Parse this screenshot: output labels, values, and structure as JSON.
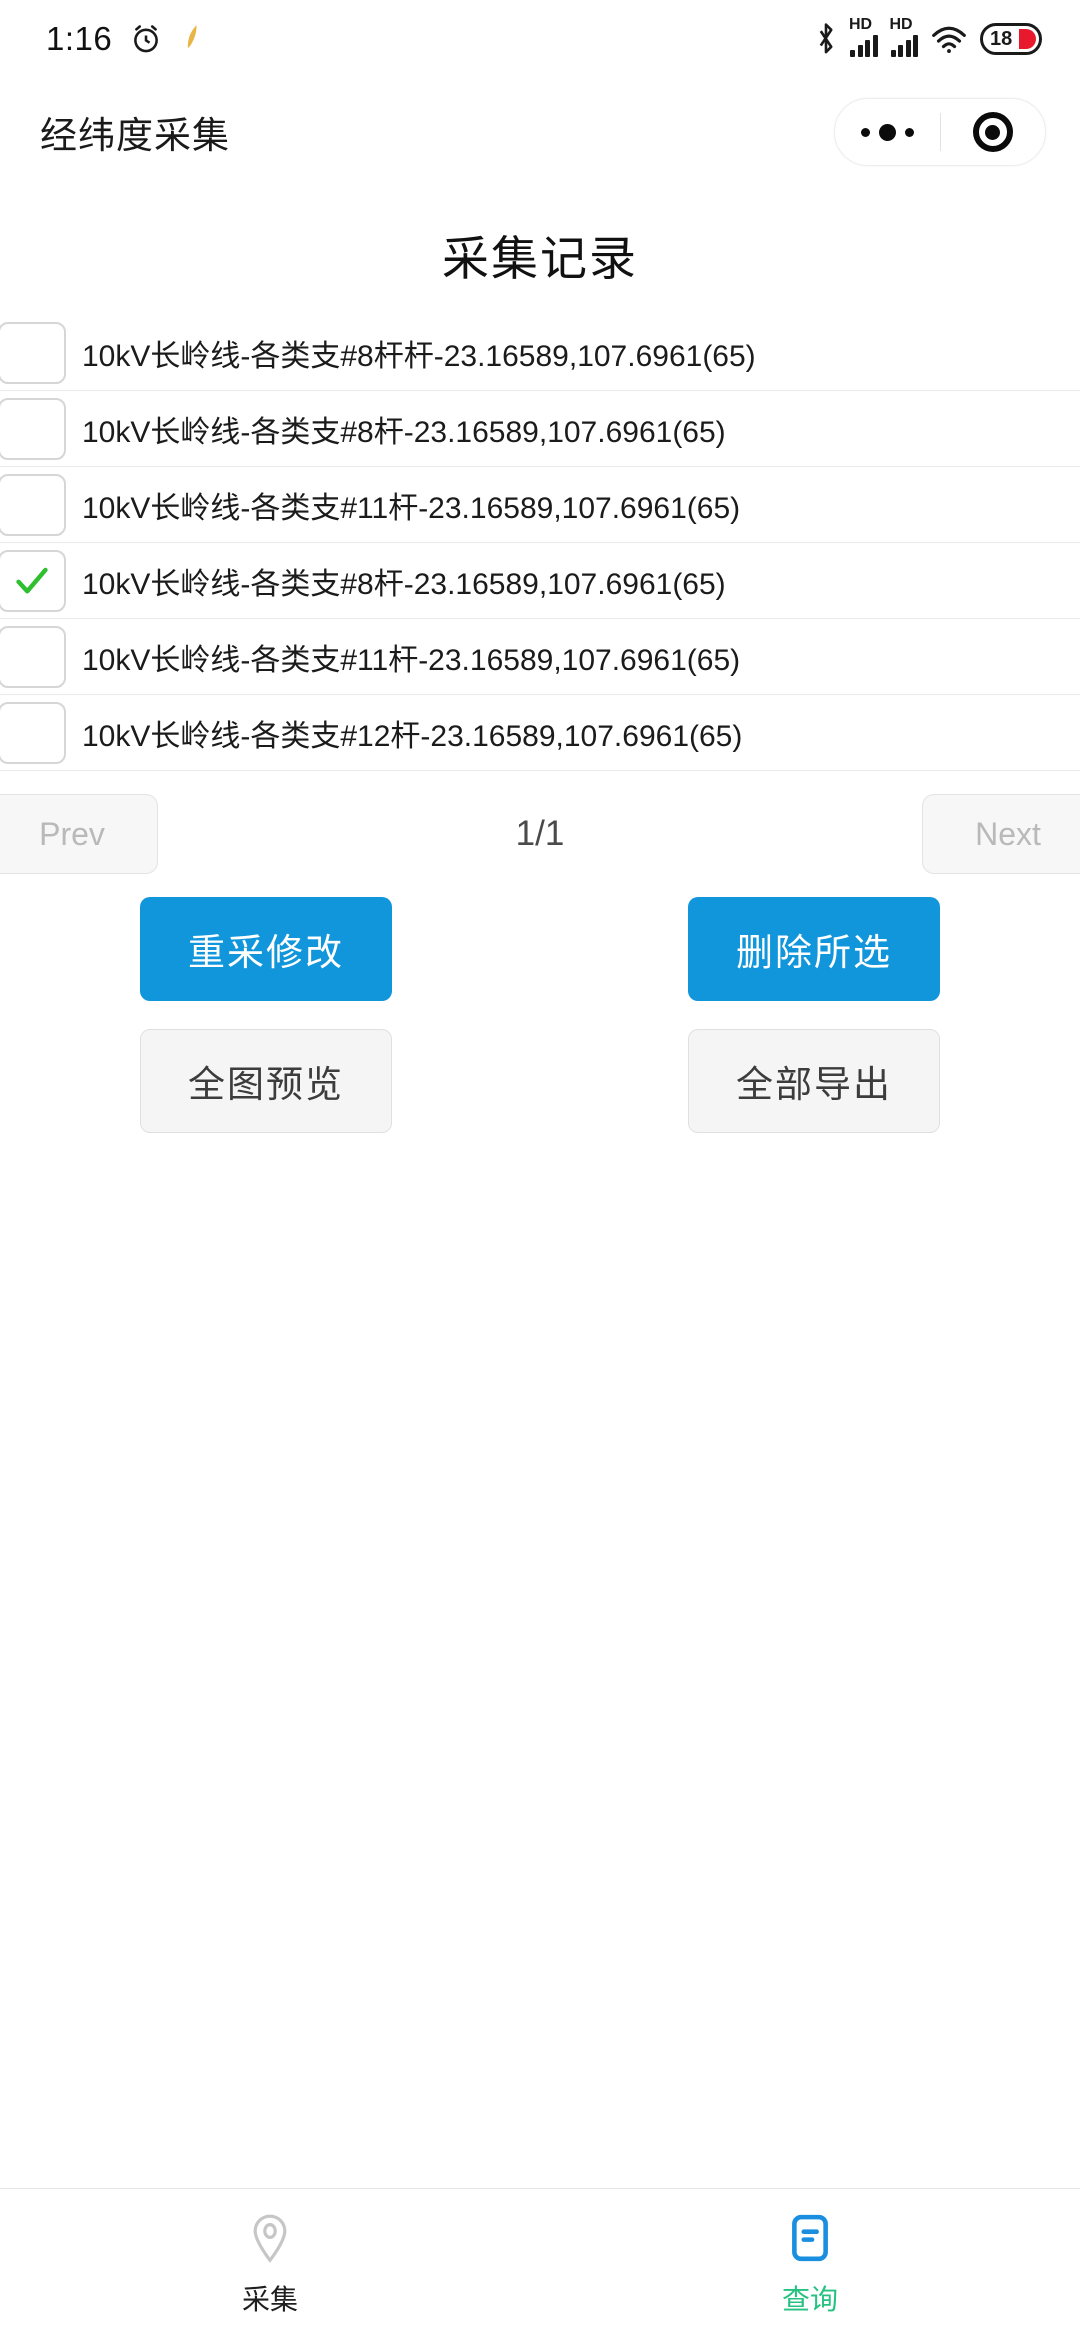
{
  "status_bar": {
    "time": "1:16",
    "alarm_icon": "alarm-clock-icon",
    "feather_icon": "feather-icon",
    "bluetooth_icon": "bluetooth-icon",
    "signal1_label": "HD",
    "signal2_label": "HD",
    "wifi_icon": "wifi-icon",
    "battery_level": "18"
  },
  "header": {
    "app_title": "经纬度采集",
    "more_icon": "more-dots-icon",
    "target_icon": "target-circle-icon"
  },
  "page": {
    "title": "采集记录"
  },
  "records": [
    {
      "label": "10kV长岭线-各类支#8杆杆-23.16589,107.6961(65)",
      "checked": false
    },
    {
      "label": "10kV长岭线-各类支#8杆-23.16589,107.6961(65)",
      "checked": false
    },
    {
      "label": "10kV长岭线-各类支#11杆-23.16589,107.6961(65)",
      "checked": false
    },
    {
      "label": "10kV长岭线-各类支#8杆-23.16589,107.6961(65)",
      "checked": true
    },
    {
      "label": "10kV长岭线-各类支#11杆-23.16589,107.6961(65)",
      "checked": false
    },
    {
      "label": "10kV长岭线-各类支#12杆-23.16589,107.6961(65)",
      "checked": false
    }
  ],
  "pagination": {
    "prev_label": "Prev",
    "next_label": "Next",
    "page_info": "1/1"
  },
  "actions": {
    "recollect_label": "重采修改",
    "delete_selected_label": "删除所选",
    "map_preview_label": "全图预览",
    "export_all_label": "全部导出"
  },
  "tabbar": {
    "collect_label": "采集",
    "collect_icon": "location-pin-icon",
    "query_label": "查询",
    "query_icon": "document-list-icon"
  },
  "colors": {
    "primary_blue": "#1296db",
    "active_green": "#26c281",
    "check_green": "#2fbf2f",
    "battery_red": "#e8192c"
  }
}
